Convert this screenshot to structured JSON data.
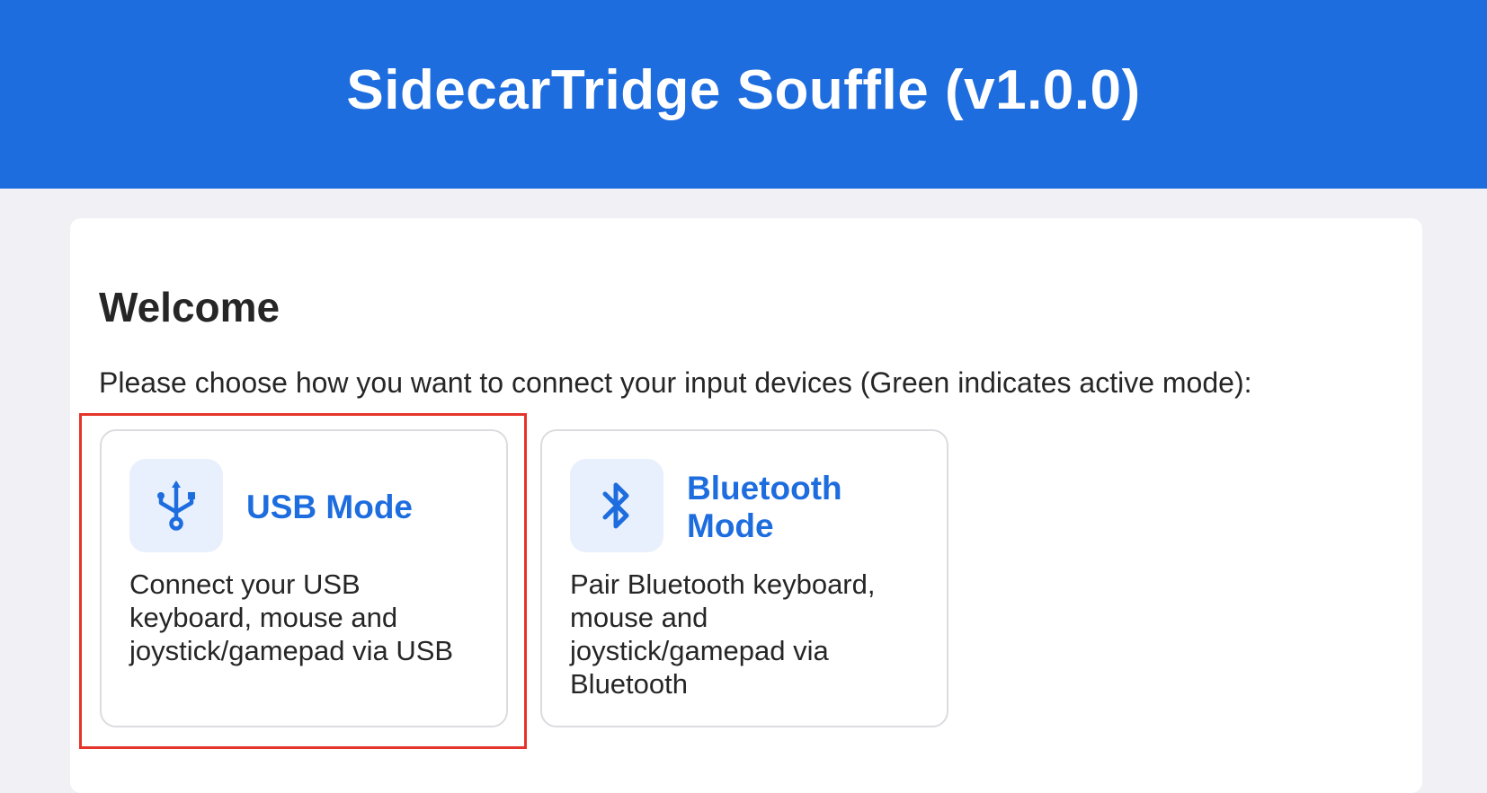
{
  "header": {
    "title": "SidecarTridge Souffle (v1.0.0)"
  },
  "welcome": {
    "heading": "Welcome",
    "instructions": "Please choose how you want to connect your input devices (Green indicates active mode):"
  },
  "modes": [
    {
      "title": "USB Mode",
      "description": "Connect your USB keyboard, mouse and joystick/gamepad via USB",
      "icon": "usb-icon"
    },
    {
      "title": "Bluetooth Mode",
      "description": "Pair Bluetooth keyboard, mouse and joystick/gamepad via Bluetooth",
      "icon": "bluetooth-icon"
    }
  ],
  "colors": {
    "header_bg": "#1e6ddf",
    "accent": "#1e6ddf",
    "icon_bg": "#e8f0fd",
    "highlight": "#e5352a",
    "page_bg": "#f0f0f5"
  }
}
